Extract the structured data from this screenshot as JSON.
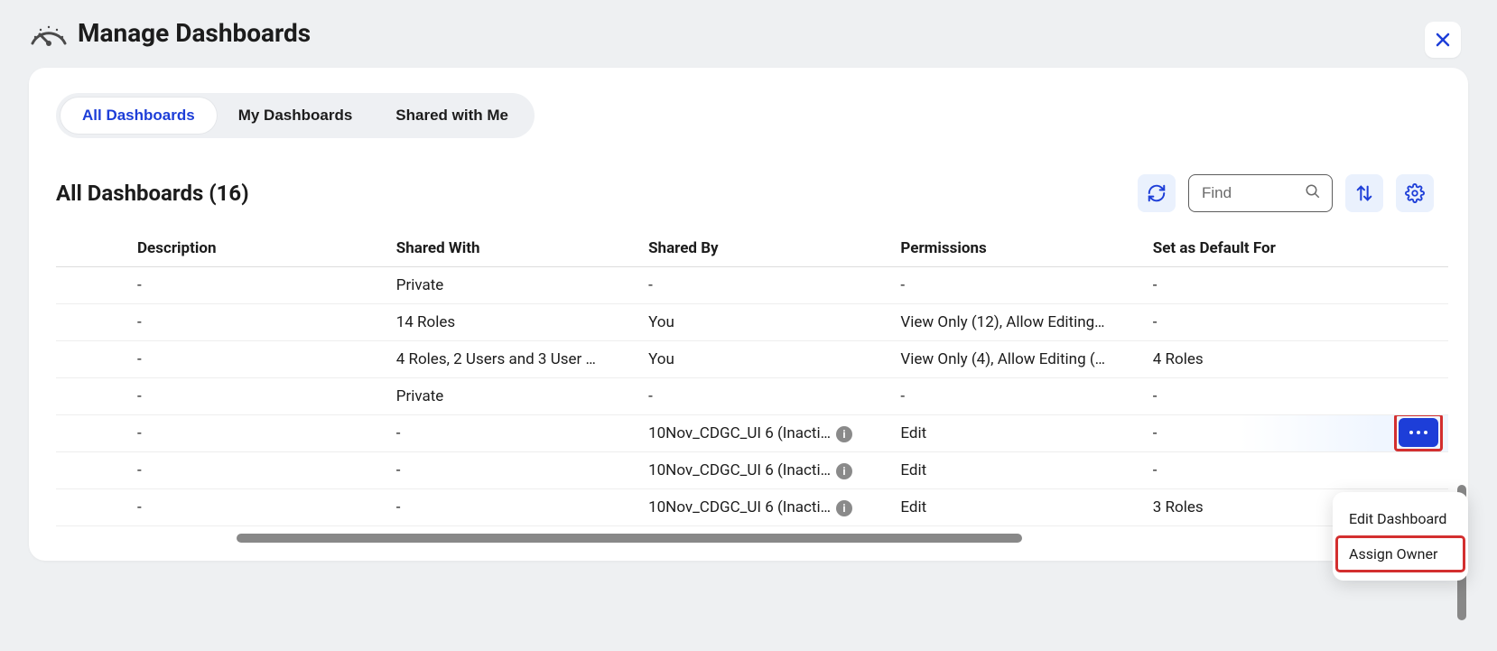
{
  "page_title": "Manage Dashboards",
  "tabs": [
    {
      "label": "All Dashboards",
      "active": true
    },
    {
      "label": "My Dashboards",
      "active": false
    },
    {
      "label": "Shared with Me",
      "active": false
    }
  ],
  "section_title": "All Dashboards (16)",
  "search": {
    "placeholder": "Find",
    "value": ""
  },
  "columns": {
    "description": "Description",
    "shared_with": "Shared With",
    "shared_by": "Shared By",
    "permissions": "Permissions",
    "set_default": "Set as Default For"
  },
  "rows": [
    {
      "description": "-",
      "shared_with": "Private",
      "shared_by": "-",
      "permissions": "-",
      "set_default": "-"
    },
    {
      "description": "-",
      "shared_with": "14 Roles",
      "shared_by": "You",
      "permissions": "View Only (12), Allow Editing…",
      "set_default": "-"
    },
    {
      "description": "-",
      "shared_with": "4 Roles, 2 Users and 3 User …",
      "shared_by": "You",
      "permissions": "View Only (4), Allow Editing (…",
      "set_default": "4 Roles"
    },
    {
      "description": "-",
      "shared_with": "Private",
      "shared_by": "-",
      "permissions": "-",
      "set_default": "-"
    },
    {
      "description": "-",
      "shared_with": "-",
      "shared_by": "10Nov_CDGC_UI 6 (Inacti…",
      "shared_by_info": true,
      "permissions": "Edit",
      "set_default": "-",
      "active": true
    },
    {
      "description": "-",
      "shared_with": "-",
      "shared_by": "10Nov_CDGC_UI 6 (Inacti…",
      "shared_by_info": true,
      "permissions": "Edit",
      "set_default": "-"
    },
    {
      "description": "-",
      "shared_with": "-",
      "shared_by": "10Nov_CDGC_UI 6 (Inacti…",
      "shared_by_info": true,
      "permissions": "Edit",
      "set_default": "3 Roles"
    }
  ],
  "context_menu": {
    "edit": "Edit Dashboard",
    "assign": "Assign Owner"
  }
}
